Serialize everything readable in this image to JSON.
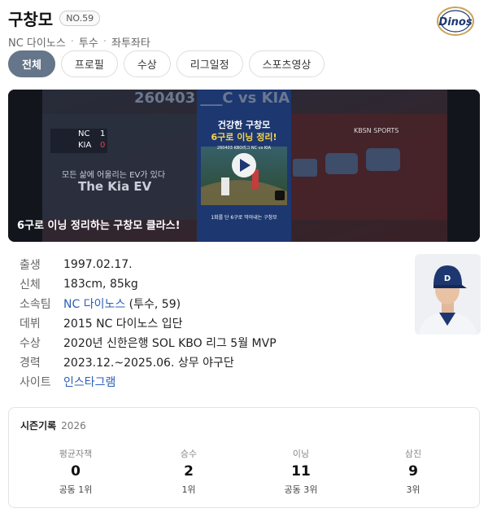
{
  "player": {
    "name": "구창모",
    "number": "NO.59",
    "team": "NC 다이노스",
    "position": "투수",
    "throw_bat": "좌투좌타",
    "separator": "·",
    "logo_text": "Dinos"
  },
  "tabs": [
    {
      "label": "전체",
      "active": true
    },
    {
      "label": "프로필"
    },
    {
      "label": "수상"
    },
    {
      "label": "리그일정"
    },
    {
      "label": "스포츠영상"
    }
  ],
  "video": {
    "caption": "6구로 이닝 정리하는 구창모 클라스!",
    "bg_title": "260403 ___C vs KIA",
    "card_headline_1": "건강한 구창모",
    "card_headline_2": "6구로 이닝 정리!",
    "card_match": "260403 KBO리그 NC vs KIA",
    "card_footer": "1회를 단 6구로 막아내는 구창모",
    "score_team_1": "NC",
    "score_val_1": "1",
    "score_team_2": "KIA",
    "score_val_2": "0",
    "ad_text_1": "모든 삶에 어울리는 EV가 있다",
    "ad_text_2": "The Kia EV",
    "broadcaster": "KBSN SPORTS"
  },
  "info": [
    {
      "label": "출생",
      "value": "1997.02.17."
    },
    {
      "label": "신체",
      "value": "183cm, 85kg"
    },
    {
      "label": "소속팀",
      "link": "NC 다이노스",
      "value": " (투수, 59)"
    },
    {
      "label": "데뷔",
      "value": "2015 NC 다이노스 입단"
    },
    {
      "label": "수상",
      "value": "2020년 신한은행 SOL KBO 리그 5월 MVP"
    },
    {
      "label": "경력",
      "value": "2023.12.~2025.06. 상무 야구단"
    },
    {
      "label": "사이트",
      "link": "인스타그램",
      "value": ""
    }
  ],
  "season": {
    "title": "시즌기록",
    "year": "2026",
    "stats": [
      {
        "label": "평균자책",
        "value": "0",
        "rank": "공동 1위"
      },
      {
        "label": "승수",
        "value": "2",
        "rank": "1위"
      },
      {
        "label": "이닝",
        "value": "11",
        "rank": "공동 3위"
      },
      {
        "label": "삼진",
        "value": "9",
        "rank": "3위"
      }
    ]
  },
  "colors": {
    "active_tab": "#65758a",
    "link": "#2b5fb8",
    "video_card": "#1d3770",
    "headline_yellow": "#f6d64a"
  }
}
